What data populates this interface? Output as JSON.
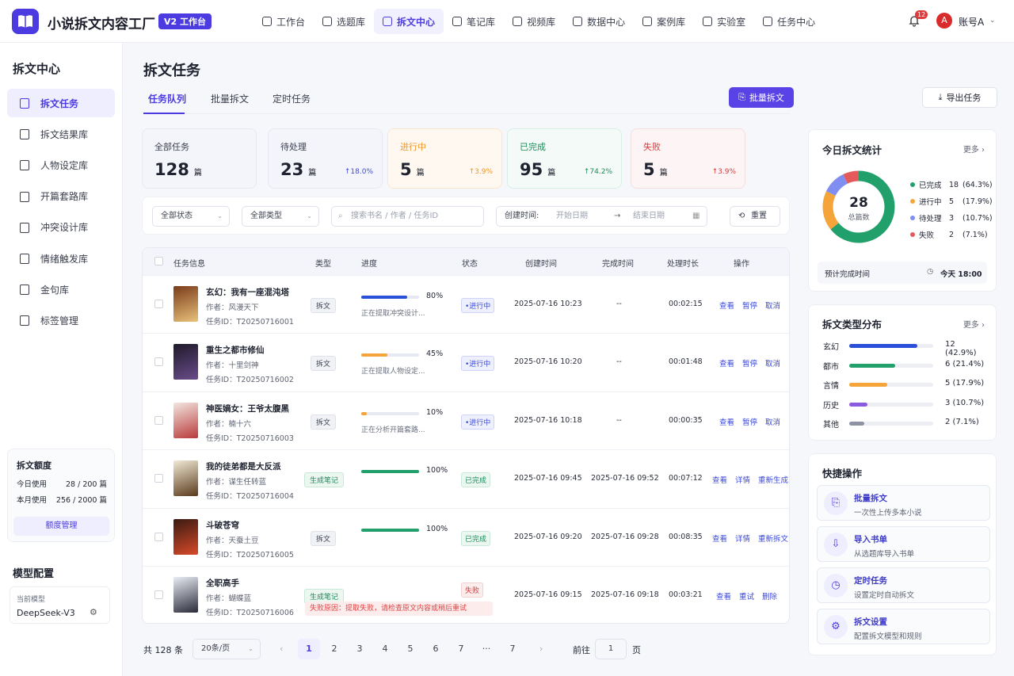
{
  "app": {
    "name": "小说拆文内容工厂",
    "version_badge": "V2 工作台"
  },
  "nav": [
    "工作台",
    "选题库",
    "拆文中心",
    "笔记库",
    "视频库",
    "数据中心",
    "案例库",
    "实验室",
    "任务中心"
  ],
  "nav_active_index": 2,
  "header": {
    "notifications": "12",
    "avatar_letter": "A",
    "account": "账号A"
  },
  "sidebar": {
    "title": "拆文中心",
    "items": [
      "拆文任务",
      "拆文结果库",
      "人物设定库",
      "开篇套路库",
      "冲突设计库",
      "情绪触发库",
      "金句库",
      "标签管理"
    ],
    "active_index": 0,
    "quota": {
      "title": "拆文额度",
      "today_label": "今日使用",
      "today_value": "28 / 200 篇",
      "month_label": "本月使用",
      "month_value": "256 / 2000 篇",
      "button": "额度管理"
    },
    "model": {
      "title": "模型配置",
      "label": "当前模型",
      "value": "DeepSeek-V3"
    }
  },
  "page": {
    "title": "拆文任务",
    "tabs": [
      "任务队列",
      "批量拆文",
      "定时任务"
    ],
    "batch_button": "批量拆文",
    "export_button": "导出任务"
  },
  "stats": [
    {
      "label": "全部任务",
      "value": "128",
      "unit": "篇",
      "change": "",
      "color": "#1f2330",
      "bg": "#f4f5fb",
      "border": "#e6e9f2"
    },
    {
      "label": "待处理",
      "value": "23",
      "unit": "篇",
      "change": "↑18.0%",
      "color": "#1f2330",
      "change_color": "#3d4bd8",
      "bg": "#f4f5fb",
      "border": "#e6e9f2"
    },
    {
      "label": "进行中",
      "value": "5",
      "unit": "篇",
      "change": "↑3.9%",
      "color": "#f0962a",
      "change_color": "#f0962a",
      "bg": "#fff8f0",
      "border": "#f9e6cf"
    },
    {
      "label": "已完成",
      "value": "95",
      "unit": "篇",
      "change": "↑74.2%",
      "color": "#1d8a5a",
      "change_color": "#1d8a5a",
      "bg": "#f4faf7",
      "border": "#d9efe4"
    },
    {
      "label": "失败",
      "value": "5",
      "unit": "篇",
      "change": "↑3.9%",
      "color": "#d83a3a",
      "change_color": "#d83a3a",
      "bg": "#fdf5f5",
      "border": "#f5dede"
    }
  ],
  "filters": {
    "status": "全部状态",
    "type": "全部类型",
    "search_placeholder": "搜索书名 / 作者 / 任务ID",
    "date_label": "创建时间:",
    "start": "开始日期",
    "arrow": "→",
    "end": "结束日期",
    "reset": "重置"
  },
  "table": {
    "headers": [
      "任务信息",
      "类型",
      "进度",
      "状态",
      "创建时间",
      "完成时间",
      "处理时长",
      "操作"
    ],
    "rows": [
      {
        "title": "玄幻：我有一座混沌塔",
        "author": "作者：风漫天下",
        "id": "任务ID：T20250716001",
        "type": "拆文",
        "progress": 0.8,
        "pct": "80%",
        "note": "正在提取冲突设计...",
        "status": "•进行中",
        "created": "2025-07-16 10:23",
        "finished": "--",
        "duration": "00:02:15",
        "ops": [
          "查看",
          "暂停",
          "取消"
        ],
        "cover": [
          "#7a3b1a",
          "#e8c27a"
        ]
      },
      {
        "title": "重生之都市修仙",
        "author": "作者：十里剑神",
        "id": "任务ID：T20250716002",
        "type": "拆文",
        "progress": 0.45,
        "pct": "45%",
        "note": "正在提取人物设定...",
        "status": "•进行中",
        "created": "2025-07-16 10:20",
        "finished": "--",
        "duration": "00:01:48",
        "ops": [
          "查看",
          "暂停",
          "取消"
        ],
        "cover": [
          "#1e1a2a",
          "#6a4c8a"
        ]
      },
      {
        "title": "神医嫡女：王爷太腹黑",
        "author": "作者：楠十六",
        "id": "任务ID：T20250716003",
        "type": "拆文",
        "progress": 0.1,
        "pct": "10%",
        "note": "正在分析开篇套路...",
        "status": "•进行中",
        "created": "2025-07-16 10:18",
        "finished": "--",
        "duration": "00:00:35",
        "ops": [
          "查看",
          "暂停",
          "取消"
        ],
        "cover": [
          "#f3e6e0",
          "#b83a3a"
        ]
      },
      {
        "title": "我的徒弟都是大反派",
        "author": "作者：谋生任转蓝",
        "id": "任务ID：T20250716004",
        "type": "生成笔记",
        "progress": 1,
        "pct": "100%",
        "note": "",
        "status": "已完成",
        "created": "2025-07-16 09:45",
        "finished": "2025-07-16 09:52",
        "duration": "00:07:12",
        "ops": [
          "查看",
          "详情",
          "重新生成"
        ],
        "cover": [
          "#f1ead6",
          "#5a3a1a"
        ]
      },
      {
        "title": "斗破苍穹",
        "author": "作者：天蚕土豆",
        "id": "任务ID：T20250716005",
        "type": "拆文",
        "progress": 1,
        "pct": "100%",
        "note": "",
        "status": "已完成",
        "created": "2025-07-16 09:20",
        "finished": "2025-07-16 09:28",
        "duration": "00:08:35",
        "ops": [
          "查看",
          "详情",
          "重新拆文"
        ],
        "cover": [
          "#3a1a12",
          "#d84a2a"
        ]
      },
      {
        "title": "全职高手",
        "author": "作者：蝴蝶蓝",
        "id": "任务ID：T20250716006",
        "type": "生成笔记",
        "progress": 0,
        "pct": "",
        "note": "",
        "status": "失败",
        "fail_reason": "失败原因：提取失败，请检查原文内容或稍后重试",
        "created": "2025-07-16 09:15",
        "finished": "2025-07-16 09:18",
        "duration": "00:03:21",
        "ops": [
          "查看",
          "重试",
          "删除"
        ],
        "cover": [
          "#e9edf4",
          "#2a2a3a"
        ]
      }
    ]
  },
  "pager": {
    "total": "共 128 条",
    "size": "20条/页",
    "pages": [
      "1",
      "2",
      "3",
      "4",
      "5",
      "6",
      "7",
      "···",
      "7"
    ],
    "goto": "前往",
    "goto_value": "1",
    "page_unit": "页"
  },
  "today_stats": {
    "title": "今日拆文统计",
    "more": "更多",
    "total": "28",
    "total_label": "总篇数",
    "legend": [
      {
        "label": "已完成",
        "count": "18",
        "pct": "(64.3%)",
        "value": 18,
        "color": "#22a06b"
      },
      {
        "label": "进行中",
        "count": "5",
        "pct": "(17.9%)",
        "value": 5,
        "color": "#f5a43a"
      },
      {
        "label": "待处理",
        "count": "3",
        "pct": "(10.7%)",
        "value": 3,
        "color": "#7f8ef0"
      },
      {
        "label": "失败",
        "count": "2",
        "pct": "(7.1%)",
        "value": 2,
        "color": "#e45a5a"
      }
    ],
    "eta_label": "预计完成时间",
    "eta_value": "今天 18:00"
  },
  "type_dist": {
    "title": "拆文类型分布",
    "more": "更多",
    "rows": [
      {
        "label": "玄幻",
        "value": "12 (42.9%)",
        "fraction": 0.81,
        "color": "#2a4fd8"
      },
      {
        "label": "都市",
        "value": "6 (21.4%)",
        "fraction": 0.55,
        "color": "#22a06b"
      },
      {
        "label": "言情",
        "value": "5 (17.9%)",
        "fraction": 0.45,
        "color": "#f5a43a"
      },
      {
        "label": "历史",
        "value": "3 (10.7%)",
        "fraction": 0.22,
        "color": "#8a5ae0"
      },
      {
        "label": "其他",
        "value": "2 (7.1%)",
        "fraction": 0.18,
        "color": "#8d93a3"
      }
    ]
  },
  "quick": {
    "title": "快捷操作",
    "items": [
      {
        "title": "批量拆文",
        "desc": "一次性上传多本小说",
        "icon": "⎘"
      },
      {
        "title": "导入书单",
        "desc": "从选题库导入书单",
        "icon": "⇩"
      },
      {
        "title": "定时任务",
        "desc": "设置定时自动拆文",
        "icon": "◷"
      },
      {
        "title": "拆文设置",
        "desc": "配置拆文模型和规则",
        "icon": "⚙"
      }
    ]
  }
}
